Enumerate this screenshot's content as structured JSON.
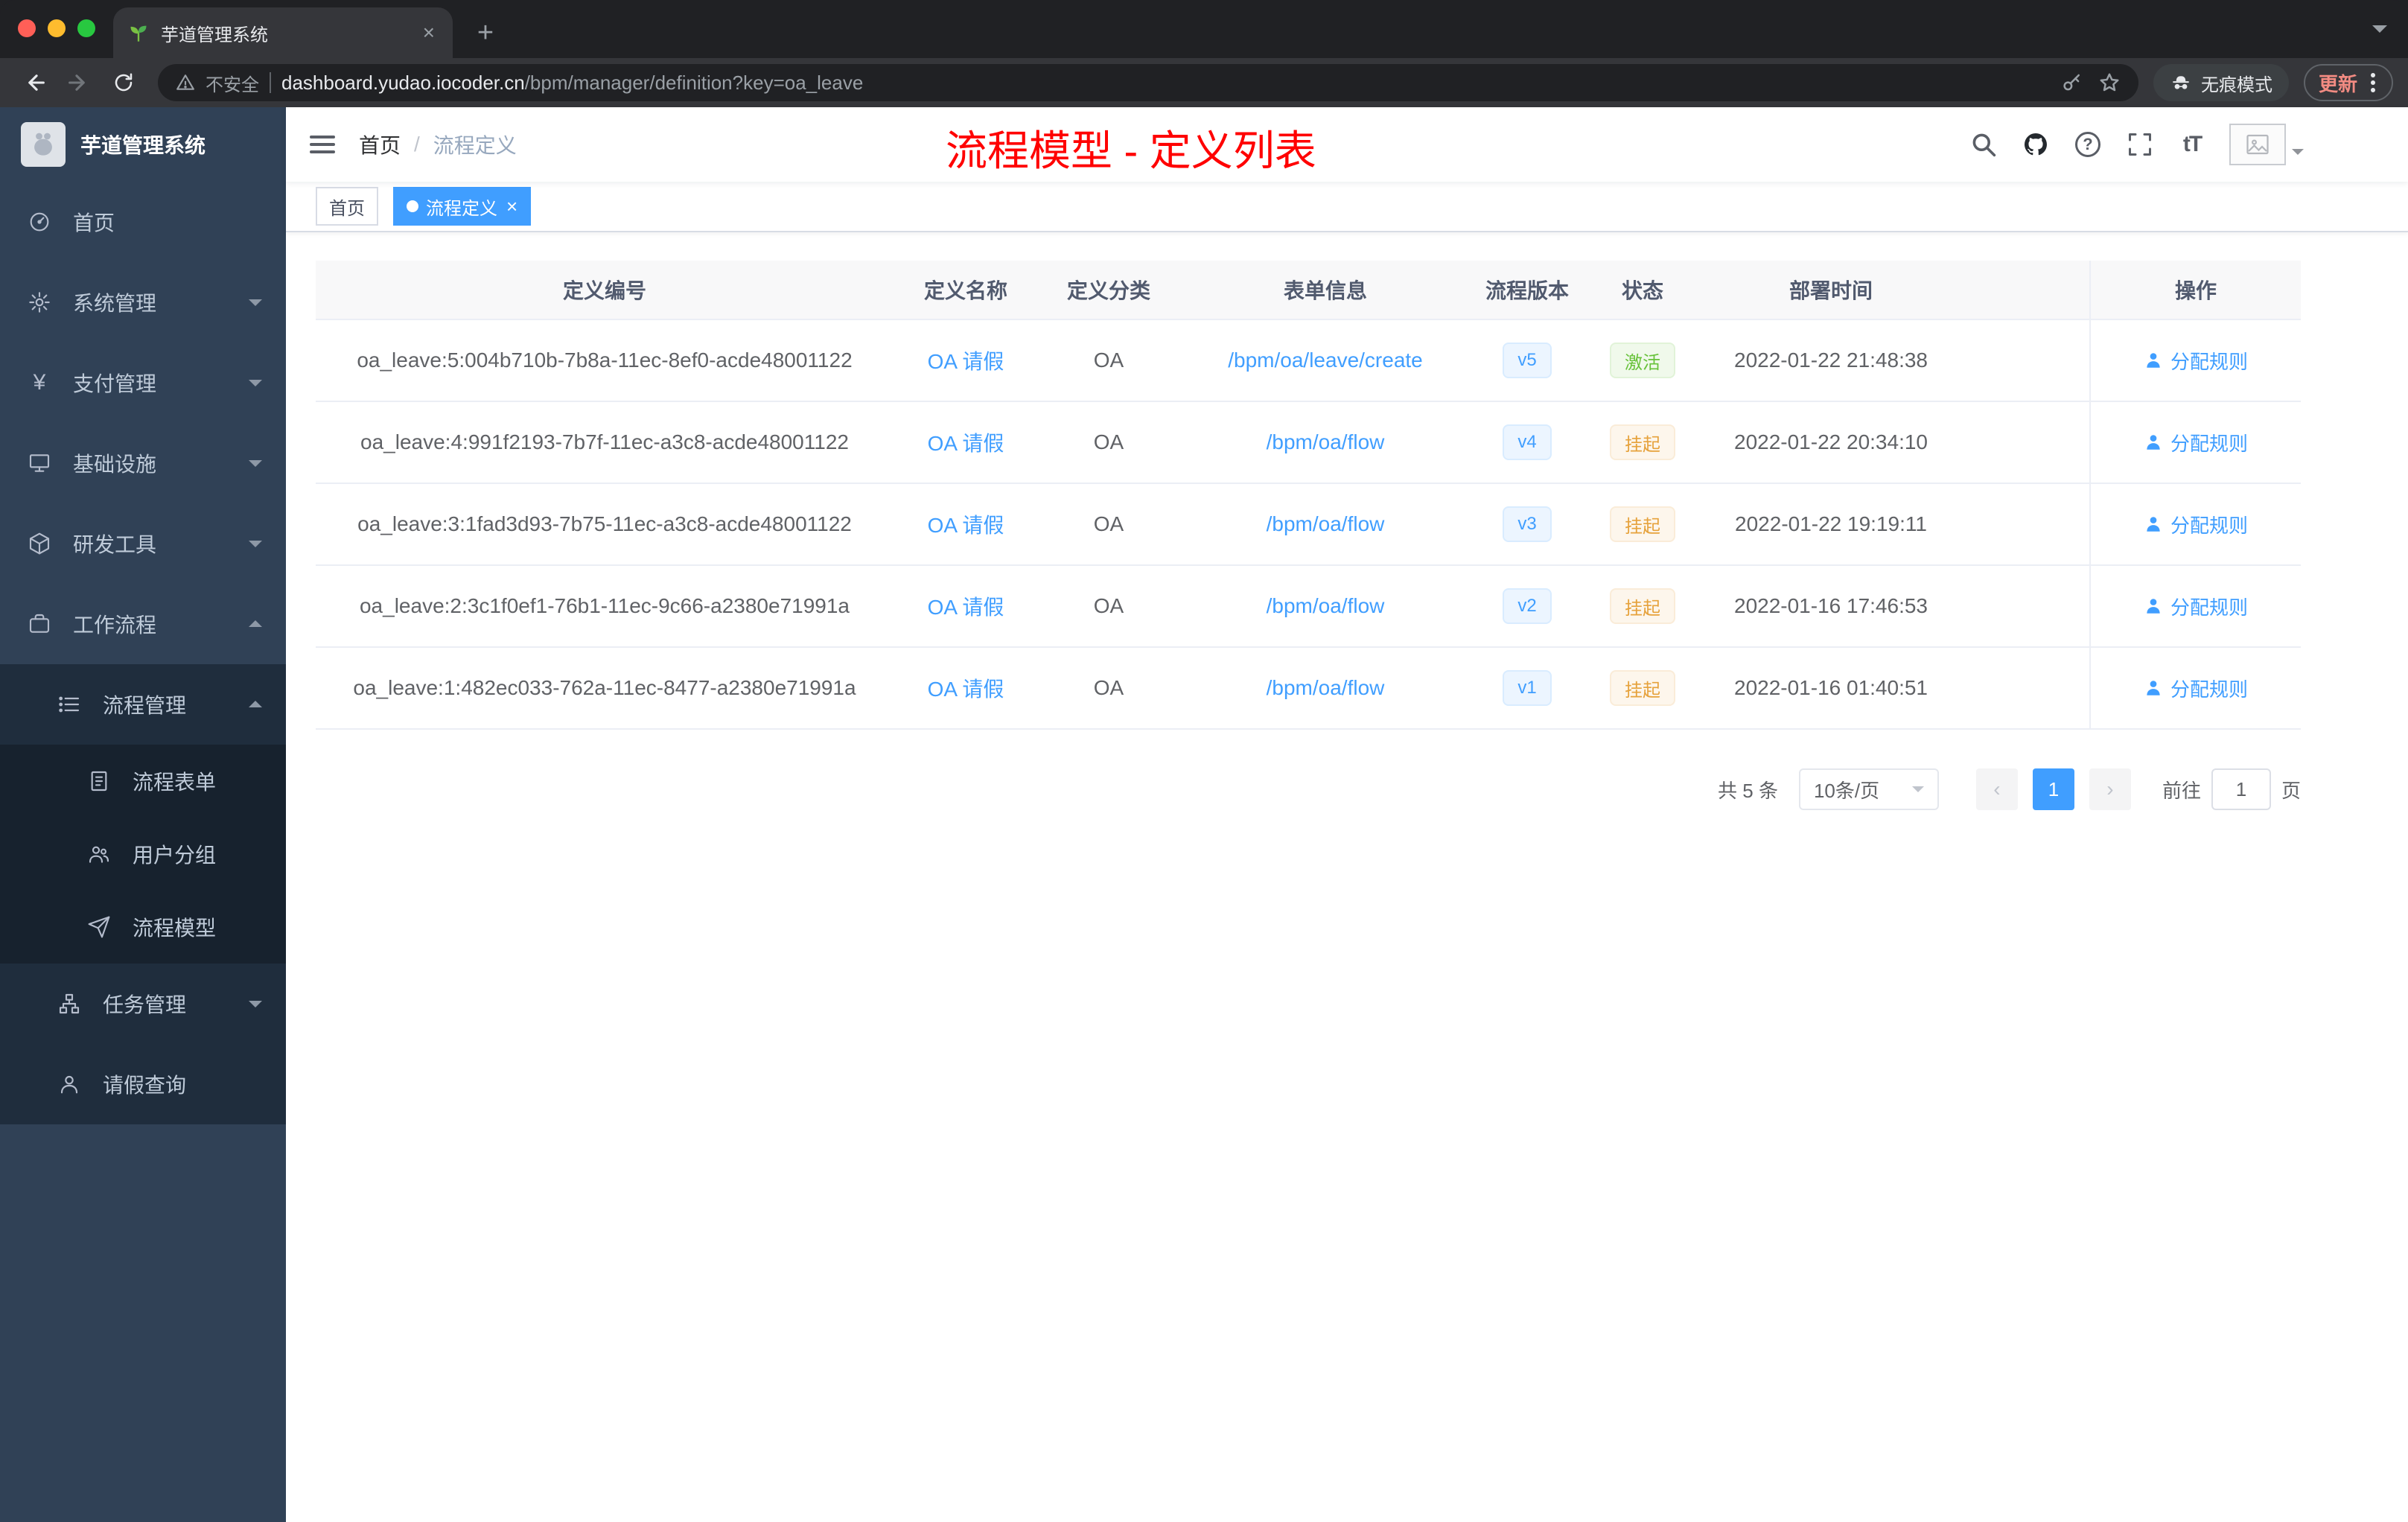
{
  "colors": {
    "accent": "#409eff",
    "success": "#67c23a",
    "warning": "#e6a23c",
    "title_red": "#ff0000",
    "sidebar_bg": "#304156",
    "sidebar_sub_bg": "#1f2d3d"
  },
  "browser": {
    "tab": {
      "title": "芋道管理系统"
    },
    "toolbar": {
      "security_label": "不安全",
      "url_host": "dashboard.yudao.iocoder.cn",
      "url_path": "/bpm/manager/definition?key=oa_leave",
      "incognito_label": "无痕模式",
      "update_label": "更新"
    }
  },
  "glyphs": {
    "close": "×",
    "plus": "+",
    "prev": "‹",
    "next": "›",
    "font_size": "tT",
    "yen": "¥",
    "question": "?",
    "broken_img": "⛰"
  },
  "sidebar": {
    "logo_title": "芋道管理系统",
    "items": [
      {
        "label": "首页"
      },
      {
        "label": "系统管理"
      },
      {
        "label": "支付管理"
      },
      {
        "label": "基础设施"
      },
      {
        "label": "研发工具"
      },
      {
        "label": "工作流程"
      },
      {
        "label": "流程管理"
      },
      {
        "label": "流程表单"
      },
      {
        "label": "用户分组"
      },
      {
        "label": "流程模型"
      },
      {
        "label": "任务管理"
      },
      {
        "label": "请假查询"
      }
    ]
  },
  "navbar": {
    "breadcrumb_home": "首页",
    "breadcrumb_sep": "/",
    "breadcrumb_current": "流程定义",
    "page_title": "流程模型 - 定义列表"
  },
  "tags": {
    "home": "首页",
    "active": "流程定义"
  },
  "table": {
    "headers": [
      "定义编号",
      "定义名称",
      "定义分类",
      "表单信息",
      "流程版本",
      "状态",
      "部署时间",
      "操作"
    ],
    "action_label": "分配规则",
    "rows": [
      {
        "id": "oa_leave:5:004b710b-7b8a-11ec-8ef0-acde48001122",
        "name": "OA 请假",
        "category": "OA",
        "form": "/bpm/oa/leave/create",
        "version": "v5",
        "status": "激活",
        "status_type": "success",
        "time": "2022-01-22 21:48:38"
      },
      {
        "id": "oa_leave:4:991f2193-7b7f-11ec-a3c8-acde48001122",
        "name": "OA 请假",
        "category": "OA",
        "form": "/bpm/oa/flow",
        "version": "v4",
        "status": "挂起",
        "status_type": "warning",
        "time": "2022-01-22 20:34:10"
      },
      {
        "id": "oa_leave:3:1fad3d93-7b75-11ec-a3c8-acde48001122",
        "name": "OA 请假",
        "category": "OA",
        "form": "/bpm/oa/flow",
        "version": "v3",
        "status": "挂起",
        "status_type": "warning",
        "time": "2022-01-22 19:19:11"
      },
      {
        "id": "oa_leave:2:3c1f0ef1-76b1-11ec-9c66-a2380e71991a",
        "name": "OA 请假",
        "category": "OA",
        "form": "/bpm/oa/flow",
        "version": "v2",
        "status": "挂起",
        "status_type": "warning",
        "time": "2022-01-16 17:46:53"
      },
      {
        "id": "oa_leave:1:482ec033-762a-11ec-8477-a2380e71991a",
        "name": "OA 请假",
        "category": "OA",
        "form": "/bpm/oa/flow",
        "version": "v1",
        "status": "挂起",
        "status_type": "warning",
        "time": "2022-01-16 01:40:51"
      }
    ]
  },
  "pagination": {
    "total": "共 5 条",
    "page_size": "10条/页",
    "current_page": "1",
    "goto_label": "前往",
    "goto_value": "1",
    "page_unit": "页"
  }
}
